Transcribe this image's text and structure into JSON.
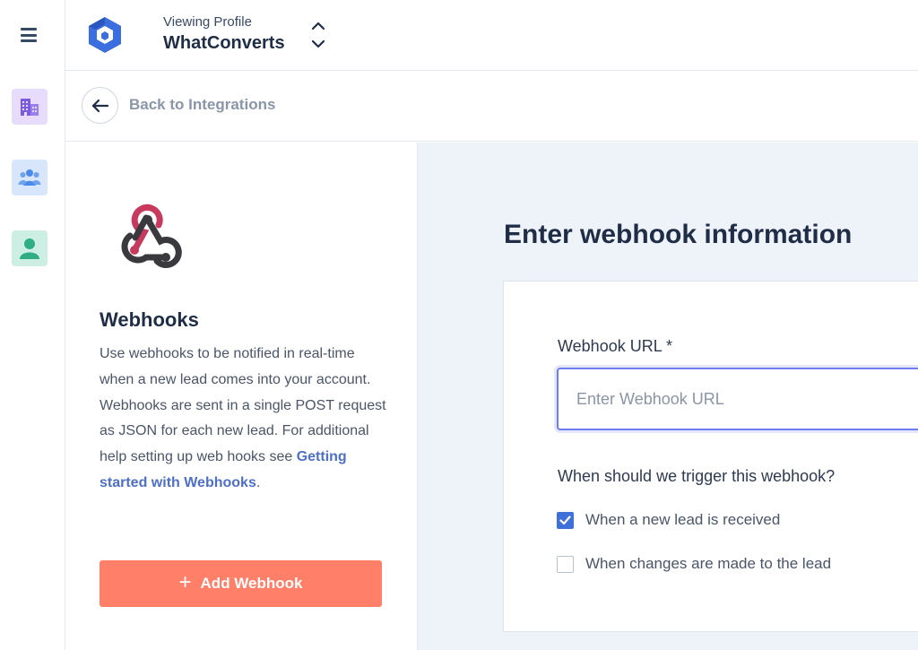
{
  "header": {
    "viewing_label": "Viewing Profile",
    "profile_name": "WhatConverts"
  },
  "rail": {
    "items": [
      {
        "name": "companies",
        "icon": "building-icon",
        "color": "#7b5ce0"
      },
      {
        "name": "team",
        "icon": "users-icon",
        "color": "#4a8ae8"
      },
      {
        "name": "profile",
        "icon": "user-icon",
        "color": "#2fae85"
      }
    ]
  },
  "back": {
    "label": "Back to Integrations"
  },
  "integration": {
    "name": "Webhooks",
    "description_before_link": "Use webhooks to be notified in real-time when a new lead comes into your account. Webhooks are sent in a single POST request as JSON for each new lead. For additional help setting up web hooks see ",
    "help_link": "Getting started with Webhooks",
    "description_after_link": ".",
    "add_button_label": "Add Webhook"
  },
  "form": {
    "heading": "Enter webhook information",
    "url_label": "Webhook URL *",
    "url_placeholder": "Enter Webhook URL",
    "url_value": "",
    "trigger_question": "When should we trigger this webhook?",
    "triggers": [
      {
        "label": "When a new lead is received",
        "checked": true
      },
      {
        "label": "When changes are made to the lead",
        "checked": false
      }
    ]
  },
  "colors": {
    "accent_button": "#ff7f69",
    "link": "#4d6fc8",
    "checkbox": "#3f6fd8",
    "logo_blue": "#3b6fe0",
    "webhook_red": "#c73a5e"
  }
}
